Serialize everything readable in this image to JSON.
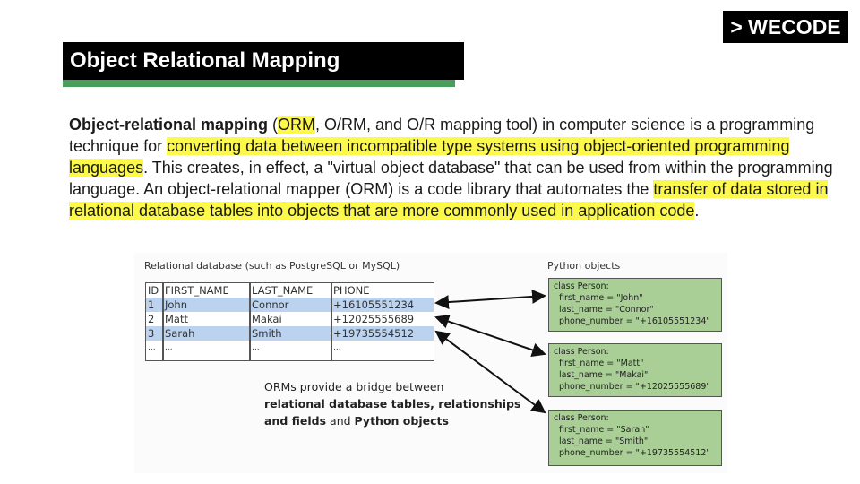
{
  "brand": "> WECODE",
  "title": "Object Relational Mapping",
  "paragraph": {
    "p1_bold": "Object-relational mapping",
    "p2": " (",
    "p3_hl": "ORM",
    "p4": ", O/RM, and O/R mapping tool) in computer science is a programming technique for ",
    "p5_hl": "converting data between incompatible type systems using object-oriented programming languages",
    "p6": ". This creates, in effect, a \"virtual object database\" that can be used from within the programming language. An object-relational mapper (ORM) is a code library that automates the ",
    "p7_hl": "transfer of data stored in relational database tables into objects that are more commonly used in application code",
    "p8": "."
  },
  "figure": {
    "db_label": "Relational database (such as PostgreSQL or MySQL)",
    "py_label": "Python objects",
    "table": {
      "columns": [
        "ID",
        "FIRST_NAME",
        "LAST_NAME",
        "PHONE"
      ],
      "rows": [
        [
          "1",
          "John",
          "Connor",
          "+16105551234"
        ],
        [
          "2",
          "Matt",
          "Makai",
          "+12025555689"
        ],
        [
          "3",
          "Sarah",
          "Smith",
          "+19735554512"
        ],
        [
          "...",
          "...",
          "...",
          "..."
        ]
      ]
    },
    "objects": [
      {
        "header": "class Person:",
        "first": "first_name = \"John\"",
        "last": "last_name = \"Connor\"",
        "phone": "phone_number = \"+16105551234\""
      },
      {
        "header": "class Person:",
        "first": "first_name = \"Matt\"",
        "last": "last_name = \"Makai\"",
        "phone": "phone_number = \"+12025555689\""
      },
      {
        "header": "class Person:",
        "first": "first_name = \"Sarah\"",
        "last": "last_name = \"Smith\"",
        "phone": "phone_number = \"+19735554512\""
      }
    ],
    "note": {
      "n1": "ORMs provide a bridge between",
      "n2_bold": "relational database tables, relationships and fields",
      "n3": " and ",
      "n4_bold": "Python objects"
    }
  },
  "colors": {
    "highlight": "#fcf94a",
    "title_underline": "#4a9e5c",
    "table_row_blue": "#bcd3ef",
    "object_box": "#a9cf96"
  }
}
